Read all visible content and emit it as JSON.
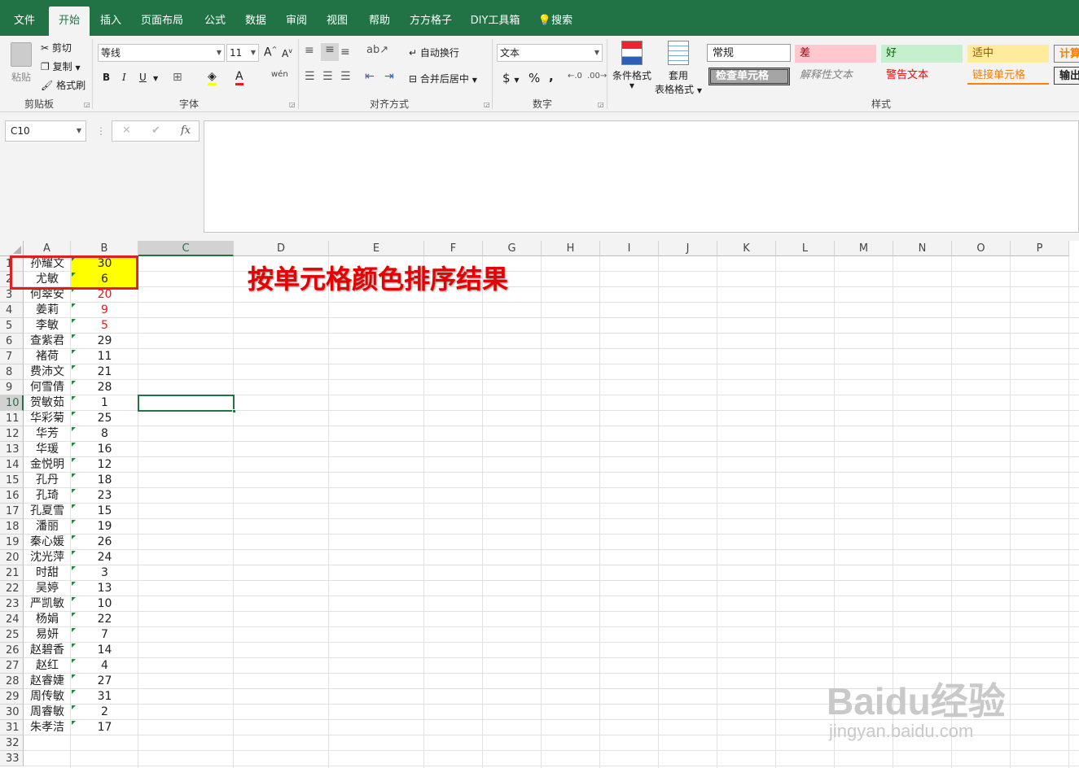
{
  "menu": {
    "tabs": [
      "文件",
      "开始",
      "插入",
      "页面布局",
      "公式",
      "数据",
      "审阅",
      "视图",
      "帮助",
      "方方格子",
      "DIY工具箱",
      "搜索"
    ],
    "active": "开始"
  },
  "ribbon": {
    "clipboard": {
      "paste": "粘贴",
      "cut": "剪切",
      "copy": "复制",
      "format_painter": "格式刷",
      "label": "剪贴板"
    },
    "font": {
      "name": "等线",
      "size": "11",
      "label": "字体",
      "bold": "B",
      "italic": "I",
      "underline": "U",
      "grow": "A",
      "shrink": "A",
      "wen": "wén"
    },
    "align": {
      "wrap": "自动换行",
      "merge": "合并后居中",
      "label": "对齐方式"
    },
    "number": {
      "format": "文本",
      "currency": "$",
      "percent": "%",
      "comma": ",",
      "label": "数字"
    },
    "styles": {
      "cond_format": "条件格式",
      "table_format_1": "套用",
      "table_format_2": "表格格式",
      "label": "样式",
      "normal": "常规",
      "bad": "差",
      "good": "好",
      "neutral": "适中",
      "calc": "计算",
      "check": "检查单元格",
      "explain": "解释性文本",
      "warn": "警告文本",
      "link": "链接单元格",
      "output": "输出"
    }
  },
  "formula_bar": {
    "name_box": "C10",
    "cancel": "✕",
    "enter": "✔",
    "fx": "fx",
    "formula": ""
  },
  "columns": [
    "A",
    "B",
    "C",
    "D",
    "E",
    "F",
    "G",
    "H",
    "I",
    "J",
    "K",
    "L",
    "M",
    "N",
    "O",
    "P"
  ],
  "rows": [
    {
      "n": "1",
      "a": "孙耀文",
      "b": "30"
    },
    {
      "n": "2",
      "a": "尤敏",
      "b": "6"
    },
    {
      "n": "3",
      "a": "何翠安",
      "b": "20"
    },
    {
      "n": "4",
      "a": "姜莉",
      "b": "9"
    },
    {
      "n": "5",
      "a": "李敏",
      "b": "5"
    },
    {
      "n": "6",
      "a": "查紫君",
      "b": "29"
    },
    {
      "n": "7",
      "a": "褚荷",
      "b": "11"
    },
    {
      "n": "8",
      "a": "费沛文",
      "b": "21"
    },
    {
      "n": "9",
      "a": "何雪倩",
      "b": "28"
    },
    {
      "n": "10",
      "a": "贺敏茹",
      "b": "1"
    },
    {
      "n": "11",
      "a": "华彩菊",
      "b": "25"
    },
    {
      "n": "12",
      "a": "华芳",
      "b": "8"
    },
    {
      "n": "13",
      "a": "华瑗",
      "b": "16"
    },
    {
      "n": "14",
      "a": "金悦明",
      "b": "12"
    },
    {
      "n": "15",
      "a": "孔丹",
      "b": "18"
    },
    {
      "n": "16",
      "a": "孔琦",
      "b": "23"
    },
    {
      "n": "17",
      "a": "孔夏雪",
      "b": "15"
    },
    {
      "n": "18",
      "a": "潘丽",
      "b": "19"
    },
    {
      "n": "19",
      "a": "秦心媛",
      "b": "26"
    },
    {
      "n": "20",
      "a": "沈光萍",
      "b": "24"
    },
    {
      "n": "21",
      "a": "时甜",
      "b": "3"
    },
    {
      "n": "22",
      "a": "吴婷",
      "b": "13"
    },
    {
      "n": "23",
      "a": "严凯敏",
      "b": "10"
    },
    {
      "n": "24",
      "a": "杨娟",
      "b": "22"
    },
    {
      "n": "25",
      "a": "易妍",
      "b": "7"
    },
    {
      "n": "26",
      "a": "赵碧香",
      "b": "14"
    },
    {
      "n": "27",
      "a": "赵红",
      "b": "4"
    },
    {
      "n": "28",
      "a": "赵睿婕",
      "b": "27"
    },
    {
      "n": "29",
      "a": "周传敏",
      "b": "31"
    },
    {
      "n": "30",
      "a": "周睿敏",
      "b": "2"
    },
    {
      "n": "31",
      "a": "朱孝洁",
      "b": "17"
    },
    {
      "n": "32",
      "a": "",
      "b": ""
    },
    {
      "n": "33",
      "a": "",
      "b": ""
    }
  ],
  "red_value_rows": [
    3,
    4,
    5
  ],
  "yellow_fill_rows": [
    1,
    2
  ],
  "colors": {
    "accent": "#217346",
    "yellow_fill": "#ffff00",
    "red_text": "#e31c1c",
    "annotation": "#e60000"
  },
  "annotation": "按单元格颜色排序结果",
  "watermark": {
    "line1": "Baidu经验",
    "line2": "jingyan.baidu.com"
  }
}
